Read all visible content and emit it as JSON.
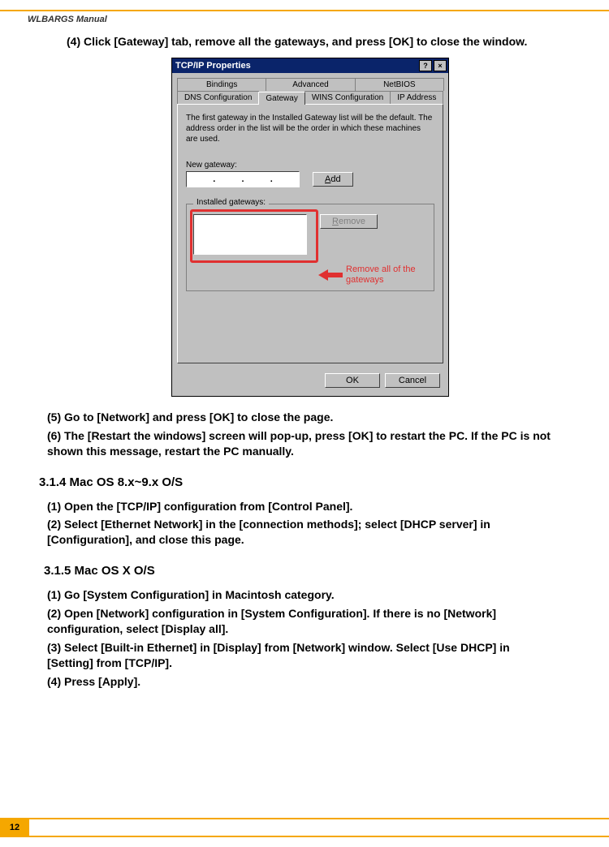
{
  "header": {
    "title": "WLBARGS Manual"
  },
  "steps_top": {
    "s4": "(4) Click [Gateway] tab, remove all the gateways, and press [OK] to close the window."
  },
  "dialog": {
    "title": "TCP/IP Properties",
    "help_btn": "?",
    "close_btn": "×",
    "tabs_back": {
      "bindings": "Bindings",
      "advanced": "Advanced",
      "netbios": "NetBIOS"
    },
    "tabs_front": {
      "dns": "DNS Configuration",
      "gateway": "Gateway",
      "wins": "WINS Configuration",
      "ip": "IP Address"
    },
    "desc": "The first gateway in the Installed Gateway list will be the default. The address order in the list will be the order in which these machines are used.",
    "new_gw_label": "New gateway:",
    "add_btn": "Add",
    "installed_label": "Installed gateways:",
    "remove_btn": "Remove",
    "ok": "OK",
    "cancel": "Cancel",
    "callout": "Remove all of the gateways"
  },
  "steps_mid": {
    "s5": "(5) Go to [Network] and press [OK] to close the page.",
    "s6": "(6) The [Restart the windows] screen will pop-up, press [OK] to restart the PC. If the PC is not shown this message, restart the PC manually."
  },
  "sect314": {
    "heading": "3.1.4 Mac OS 8.x~9.x O/S",
    "s1": "(1) Open the [TCP/IP] configuration from [Control Panel].",
    "s2": "(2) Select [Ethernet Network] in the [connection methods]; select [DHCP server] in [Configuration], and close this page."
  },
  "sect315": {
    "heading": "3.1.5 Mac OS X O/S",
    "s1": "(1) Go [System Configuration] in Macintosh category.",
    "s2": "(2) Open [Network] configuration in [System Configuration]. If there is no [Network] configuration, select [Display all].",
    "s3": "(3) Select [Built-in Ethernet] in [Display] from [Network] window. Select [Use DHCP] in [Setting] from [TCP/IP].",
    "s4": "(4) Press [Apply]."
  },
  "footer": {
    "page": "12"
  }
}
